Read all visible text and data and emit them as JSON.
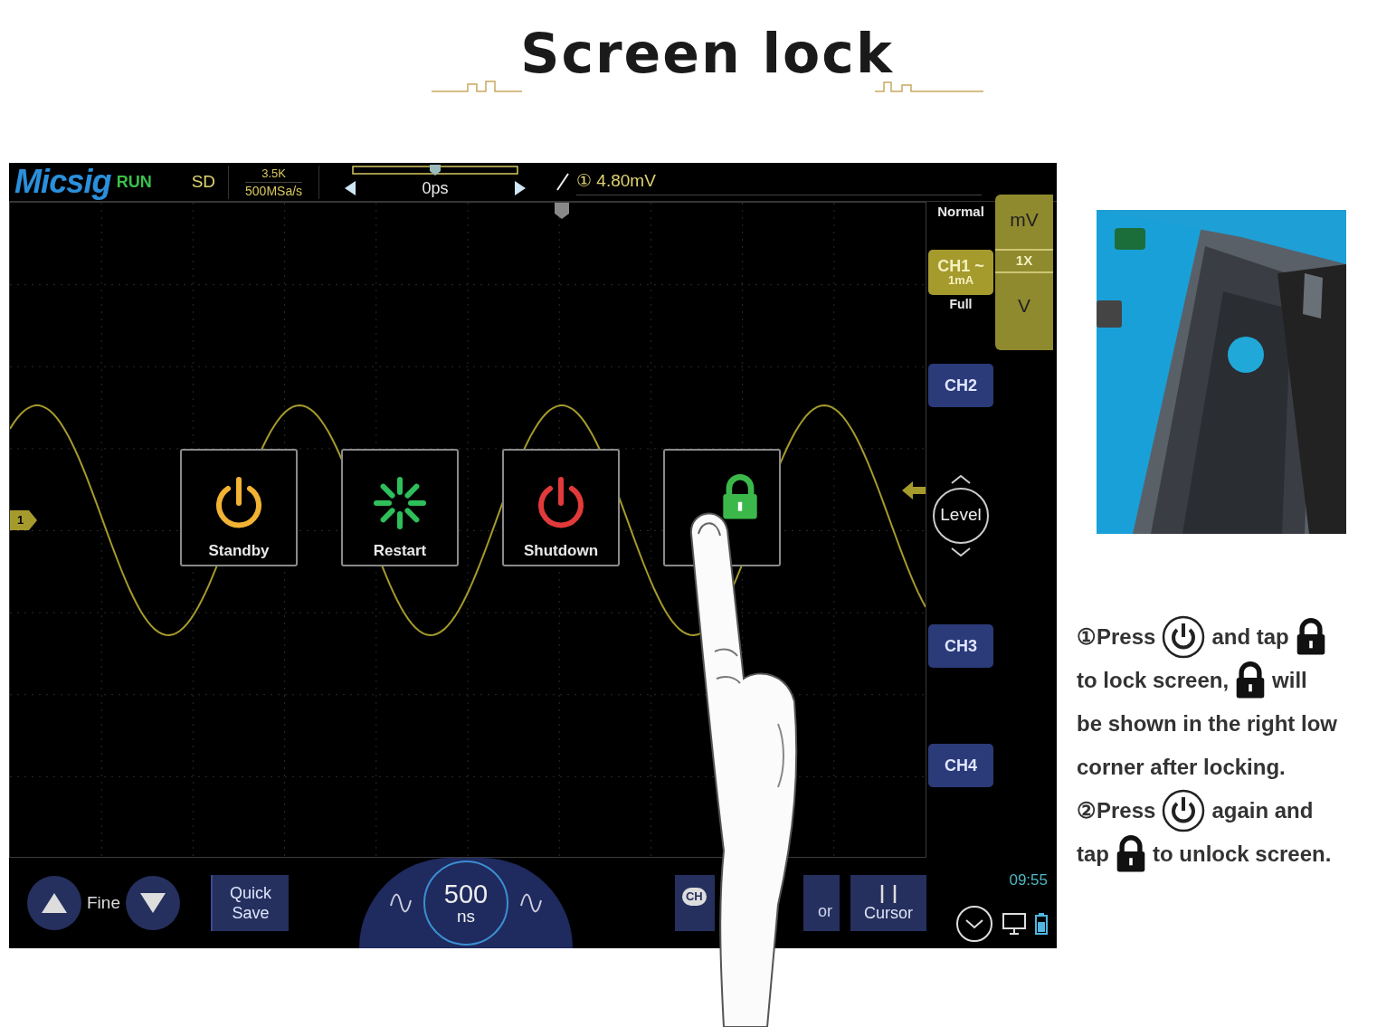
{
  "title": "Screen lock",
  "scope": {
    "brand": "Micsig",
    "run_state": "RUN",
    "storage": "SD",
    "memory_depth": "3.5K",
    "sample_rate": "500MSa/s",
    "time_offset": "0ps",
    "trigger_readout": "① 4.80mV",
    "trigger_mode": "Normal",
    "channel_marker": "1",
    "time_position": {
      "level": 0.5
    },
    "channels": [
      {
        "label": "CH1",
        "coupling": "~",
        "unit": "1mA",
        "bandwidth": "Full",
        "selected": true
      },
      {
        "label": "CH2",
        "selected": false
      },
      {
        "label": "CH3",
        "selected": false
      },
      {
        "label": "CH4",
        "selected": false
      }
    ],
    "unit_picker": [
      {
        "label": "mV",
        "selected": false
      },
      {
        "label": "1X",
        "selected": true
      },
      {
        "label": "V",
        "selected": false
      }
    ],
    "level_button": "Level",
    "power_menu": [
      {
        "kind": "standby",
        "label": "Standby"
      },
      {
        "kind": "restart",
        "label": "Restart"
      },
      {
        "kind": "shutdown",
        "label": "Shutdown"
      },
      {
        "kind": "lock"
      }
    ],
    "bottom": {
      "fine": "Fine",
      "quick_save": "Quick Save",
      "timebase_value": "500",
      "timebase_unit": "ns",
      "channel_button": "CH",
      "partial_button": "or",
      "cursor": "Cursor",
      "clock": "09:55"
    }
  },
  "instructions": [
    [
      {
        "kind": "text",
        "text": "①Press"
      },
      {
        "kind": "power"
      },
      {
        "kind": "text",
        "text": "and tap"
      },
      {
        "kind": "lock"
      }
    ],
    [
      {
        "kind": "text",
        "text": "to lock screen,"
      },
      {
        "kind": "lock"
      },
      {
        "kind": "text",
        "text": "will"
      }
    ],
    [
      {
        "kind": "text",
        "text": "be shown in the right low"
      }
    ],
    [
      {
        "kind": "text",
        "text": "corner after locking."
      }
    ],
    [
      {
        "kind": "text",
        "text": "②Press"
      },
      {
        "kind": "power"
      },
      {
        "kind": "text",
        "text": "again and"
      }
    ],
    [
      {
        "kind": "text",
        "text": "tap"
      },
      {
        "kind": "lock"
      },
      {
        "kind": "text",
        "text": "to unlock screen."
      }
    ]
  ]
}
